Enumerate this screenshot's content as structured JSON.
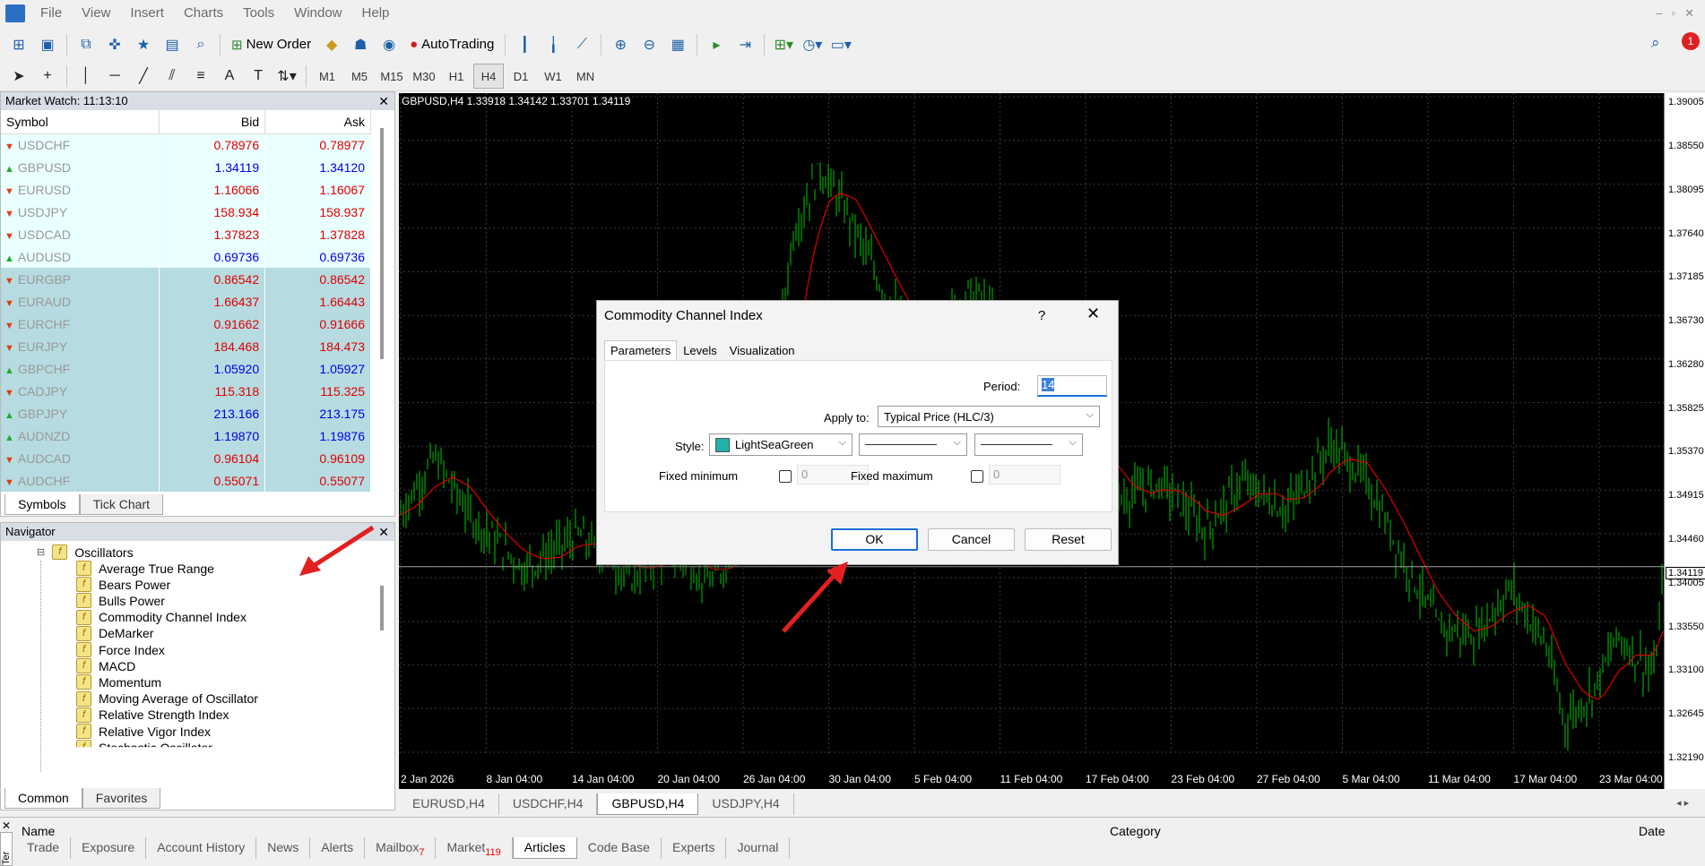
{
  "menu": [
    "File",
    "View",
    "Insert",
    "Charts",
    "Tools",
    "Window",
    "Help"
  ],
  "toolbar": {
    "new_order": "New Order",
    "autotrading": "AutoTrading"
  },
  "timeframes": [
    "M1",
    "M5",
    "M15",
    "M30",
    "H1",
    "H4",
    "D1",
    "W1",
    "MN"
  ],
  "active_timeframe": "H4",
  "market_watch": {
    "title": "Market Watch: 11:13:10",
    "columns": [
      "Symbol",
      "Bid",
      "Ask"
    ],
    "rows": [
      {
        "symbol": "USDCHF",
        "bid": "0.78976",
        "ask": "0.78977",
        "dir": "down",
        "color": "red"
      },
      {
        "symbol": "GBPUSD",
        "bid": "1.34119",
        "ask": "1.34120",
        "dir": "up",
        "color": "blue"
      },
      {
        "symbol": "EURUSD",
        "bid": "1.16066",
        "ask": "1.16067",
        "dir": "down",
        "color": "red"
      },
      {
        "symbol": "USDJPY",
        "bid": "158.934",
        "ask": "158.937",
        "dir": "down",
        "color": "red"
      },
      {
        "symbol": "USDCAD",
        "bid": "1.37823",
        "ask": "1.37828",
        "dir": "down",
        "color": "red"
      },
      {
        "symbol": "AUDUSD",
        "bid": "0.69736",
        "ask": "0.69736",
        "dir": "up",
        "color": "blue"
      },
      {
        "symbol": "EURGBP",
        "bid": "0.86542",
        "ask": "0.86542",
        "dir": "down",
        "color": "red"
      },
      {
        "symbol": "EURAUD",
        "bid": "1.66437",
        "ask": "1.66443",
        "dir": "down",
        "color": "red"
      },
      {
        "symbol": "EURCHF",
        "bid": "0.91662",
        "ask": "0.91666",
        "dir": "down",
        "color": "red"
      },
      {
        "symbol": "EURJPY",
        "bid": "184.468",
        "ask": "184.473",
        "dir": "down",
        "color": "red"
      },
      {
        "symbol": "GBPCHF",
        "bid": "1.05920",
        "ask": "1.05927",
        "dir": "up",
        "color": "blue"
      },
      {
        "symbol": "CADJPY",
        "bid": "115.318",
        "ask": "115.325",
        "dir": "down",
        "color": "red"
      },
      {
        "symbol": "GBPJPY",
        "bid": "213.166",
        "ask": "213.175",
        "dir": "up",
        "color": "blue"
      },
      {
        "symbol": "AUDNZD",
        "bid": "1.19870",
        "ask": "1.19876",
        "dir": "up",
        "color": "blue"
      },
      {
        "symbol": "AUDCAD",
        "bid": "0.96104",
        "ask": "0.96109",
        "dir": "down",
        "color": "red"
      },
      {
        "symbol": "AUDCHF",
        "bid": "0.55071",
        "ask": "0.55077",
        "dir": "down",
        "color": "red"
      }
    ],
    "tabs": [
      "Symbols",
      "Tick Chart"
    ]
  },
  "navigator": {
    "title": "Navigator",
    "folder": "Oscillators",
    "items": [
      "Average True Range",
      "Bears Power",
      "Bulls Power",
      "Commodity Channel Index",
      "DeMarker",
      "Force Index",
      "MACD",
      "Momentum",
      "Moving Average of Oscillator",
      "Relative Strength Index",
      "Relative Vigor Index",
      "Stochastic Oscillator"
    ],
    "tabs": [
      "Common",
      "Favorites"
    ]
  },
  "chart": {
    "info": "GBPUSD,H4  1.33918 1.34142 1.33701 1.34119",
    "prices": [
      "1.39005",
      "1.38550",
      "1.38095",
      "1.37640",
      "1.37185",
      "1.36730",
      "1.36280",
      "1.35825",
      "1.35370",
      "1.34915",
      "1.34460",
      "1.34119",
      "1.34005",
      "1.33550",
      "1.33100",
      "1.32645",
      "1.32190"
    ],
    "dates": [
      "2 Jan 2026",
      "8 Jan 04:00",
      "14 Jan 04:00",
      "20 Jan 04:00",
      "26 Jan 04:00",
      "30 Jan 04:00",
      "5 Feb 04:00",
      "11 Feb 04:00",
      "17 Feb 04:00",
      "23 Feb 04:00",
      "27 Feb 04:00",
      "5 Mar 04:00",
      "11 Mar 04:00",
      "17 Mar 04:00",
      "23 Mar 04:00"
    ],
    "tabs": [
      "EURUSD,H4",
      "USDCHF,H4",
      "GBPUSD,H4",
      "USDJPY,H4"
    ],
    "active_tab": "GBPUSD,H4",
    "candle_color": "#00c800",
    "ma_color": "#e00000"
  },
  "terminal": {
    "side_label": "Ter",
    "columns": [
      "Name",
      "Category",
      "Date"
    ],
    "tabs": [
      {
        "label": "Trade",
        "badge": ""
      },
      {
        "label": "Exposure",
        "badge": ""
      },
      {
        "label": "Account History",
        "badge": ""
      },
      {
        "label": "News",
        "badge": ""
      },
      {
        "label": "Alerts",
        "badge": ""
      },
      {
        "label": "Mailbox",
        "badge": "7"
      },
      {
        "label": "Market",
        "badge": "119"
      },
      {
        "label": "Articles",
        "badge": ""
      },
      {
        "label": "Code Base",
        "badge": ""
      },
      {
        "label": "Experts",
        "badge": ""
      },
      {
        "label": "Journal",
        "badge": ""
      }
    ],
    "active_tab": "Articles"
  },
  "dialog": {
    "title": "Commodity Channel Index",
    "help": "?",
    "close": "✕",
    "tabs": [
      "Parameters",
      "Levels",
      "Visualization"
    ],
    "period_label": "Period:",
    "period_value": "14",
    "apply_label": "Apply to:",
    "apply_value": "Typical Price (HLC/3)",
    "style_label": "Style:",
    "style_color_name": "LightSeaGreen",
    "style_color": "#20b2aa",
    "fixed_min_label": "Fixed minimum",
    "fixed_min_value": "0",
    "fixed_max_label": "Fixed maximum",
    "fixed_max_value": "0",
    "ok": "OK",
    "cancel": "Cancel",
    "reset": "Reset"
  }
}
